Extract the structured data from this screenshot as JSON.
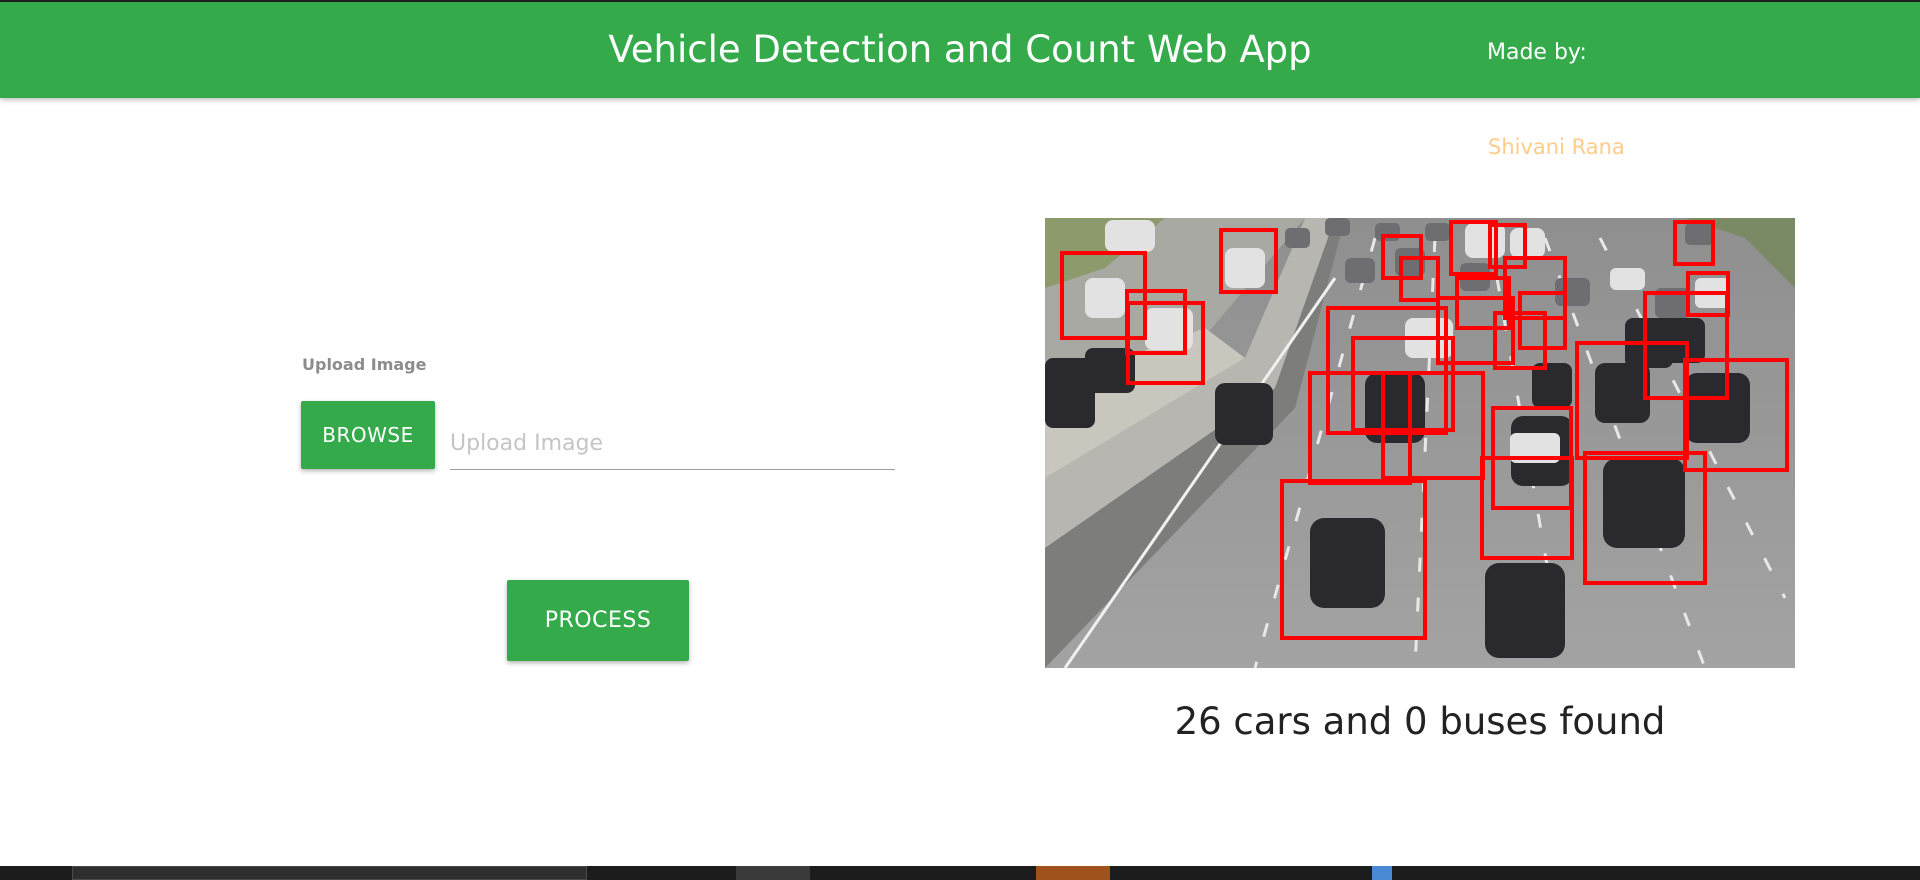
{
  "header": {
    "title": "Vehicle Detection and Count Web App",
    "made_by_label": "Made by:",
    "author": "Shivani Rana"
  },
  "upload": {
    "label": "Upload Image",
    "browse_label": "BROWSE",
    "input_placeholder": "Upload Image"
  },
  "process_label": "PROCESS",
  "result": {
    "summary": "26 cars and 0 buses found",
    "cars": 26,
    "buses": 0
  },
  "colors": {
    "accent": "#34aa4b",
    "author": "#ffcc8a",
    "detection_box": "#ff0000"
  }
}
